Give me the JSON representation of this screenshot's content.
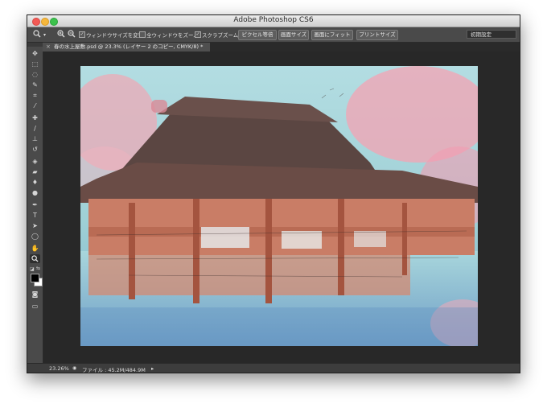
{
  "window": {
    "title": "Adobe Photoshop CS6"
  },
  "options": {
    "resize_windows": "ウィンドウサイズを変更",
    "zoom_all": "全ウィンドウをズーム",
    "scrubby_zoom": "スクラブズーム",
    "buttons": [
      "ピクセル等倍",
      "画面サイズ",
      "画面にフィット",
      "プリントサイズ"
    ],
    "workspace": "初期設定"
  },
  "tab": {
    "title": "春の水上屋敷.psd @ 23.3% (レイヤー 2 のコピー, CMYK/8) *",
    "close": "×"
  },
  "status": {
    "zoom": "23.26%",
    "file_info": "ファイル : 45.2M/484.9M",
    "arrow": "▸"
  },
  "icons": {
    "zoom": "zoom-icon",
    "zoom_in": "zoom-in-icon",
    "zoom_out": "zoom-out-icon",
    "tools": [
      "move-icon",
      "marquee-icon",
      "lasso-icon",
      "quick-select-icon",
      "crop-icon",
      "eyedropper-icon",
      "healing-icon",
      "brush-icon",
      "stamp-icon",
      "history-brush-icon",
      "eraser-icon",
      "gradient-icon",
      "blur-icon",
      "dodge-icon",
      "pen-icon",
      "type-icon",
      "path-select-icon",
      "shape-icon",
      "hand-icon",
      "zoom-tool-icon"
    ]
  },
  "colors": {
    "foreground": "#000000",
    "background": "#ffffff"
  }
}
